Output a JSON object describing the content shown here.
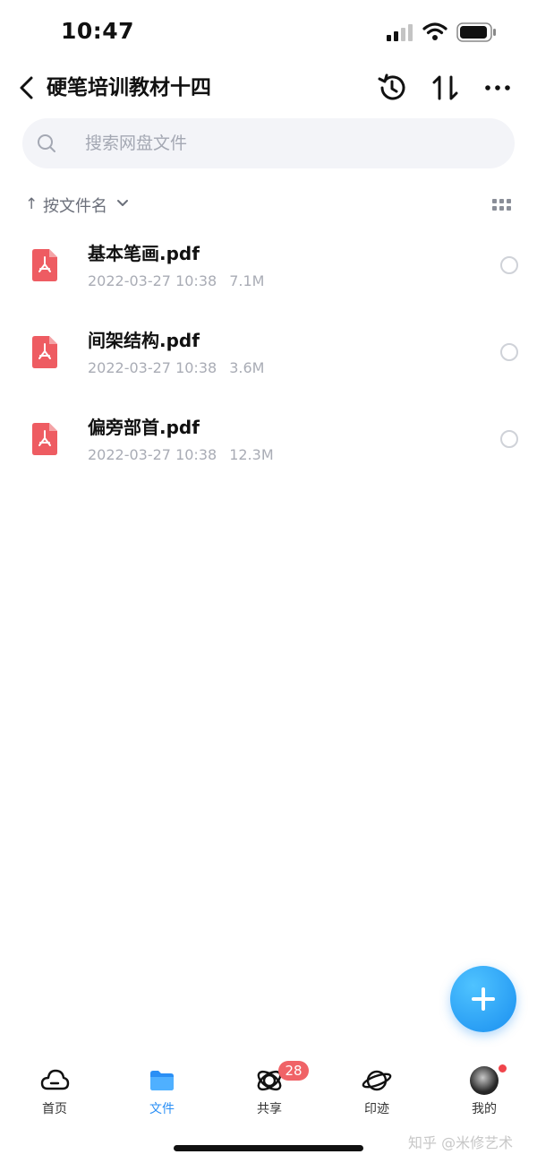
{
  "status": {
    "time": "10:47"
  },
  "nav": {
    "title": "硬笔培训教材十四"
  },
  "search": {
    "placeholder": "搜索网盘文件"
  },
  "sortbar": {
    "arrow": "↑",
    "label": "按文件名"
  },
  "files": [
    {
      "name": "基本笔画.pdf",
      "date": "2022-03-27 10:38",
      "size": "7.1M"
    },
    {
      "name": "间架结构.pdf",
      "date": "2022-03-27 10:38",
      "size": "3.6M"
    },
    {
      "name": "偏旁部首.pdf",
      "date": "2022-03-27 10:38",
      "size": "12.3M"
    }
  ],
  "tabs": [
    {
      "label": "首页"
    },
    {
      "label": "文件"
    },
    {
      "label": "共享",
      "badge": "28"
    },
    {
      "label": "印迹"
    },
    {
      "label": "我的"
    }
  ],
  "watermark": "知乎 @米修艺术",
  "colors": {
    "accent": "#2a8ff5",
    "pdf": "#ee5c62",
    "badge": "#f06367",
    "fab": "#1a8ff0"
  }
}
